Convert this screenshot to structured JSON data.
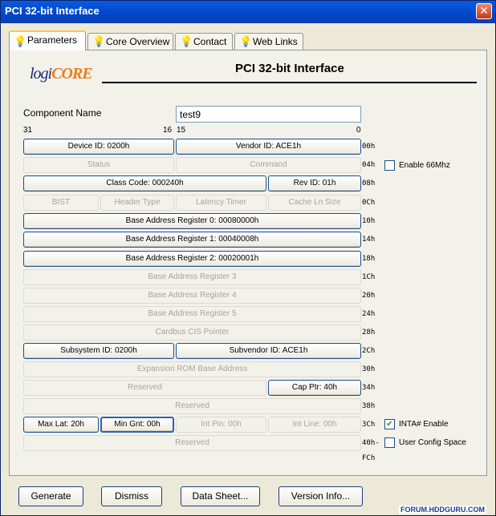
{
  "window": {
    "title": "PCI 32-bit Interface",
    "close_glyph": "✕"
  },
  "tabs": [
    {
      "label": "Parameters",
      "icon": "lightbulb-icon"
    },
    {
      "label": "Core Overview",
      "icon": "lightbulb-icon"
    },
    {
      "label": "Contact",
      "icon": "lightbulb-icon"
    },
    {
      "label": "Web Links",
      "icon": "lightbulb-icon"
    }
  ],
  "logo": {
    "text_a": "logi",
    "text_b": "CORE"
  },
  "heading": "PCI 32-bit Interface",
  "component": {
    "label": "Component Name",
    "value": "test9"
  },
  "bits": {
    "b31": "31",
    "b16": "16",
    "b15": "15",
    "b0": "0"
  },
  "rows": [
    {
      "offset": "00h",
      "cells": [
        {
          "text": "Device ID: 0200h",
          "enabled": true
        },
        {
          "text": "Vendor ID: ACE1h",
          "enabled": true
        }
      ]
    },
    {
      "offset": "04h",
      "cells": [
        {
          "text": "Status",
          "enabled": false
        },
        {
          "text": "Command",
          "enabled": false
        }
      ]
    },
    {
      "offset": "08h",
      "cells": [
        {
          "text": "Class Code: 000240h",
          "enabled": true
        },
        {
          "text": "Rev ID: 01h",
          "enabled": true
        }
      ]
    },
    {
      "offset": "0Ch",
      "cells": [
        {
          "text": "BIST",
          "enabled": false
        },
        {
          "text": "Header Type",
          "enabled": false
        },
        {
          "text": "Latency Timer",
          "enabled": false
        },
        {
          "text": "Cache Ln Size",
          "enabled": false
        }
      ]
    },
    {
      "offset": "10h",
      "cells": [
        {
          "text": "Base Address Register 0: 00080000h",
          "enabled": true
        }
      ]
    },
    {
      "offset": "14h",
      "cells": [
        {
          "text": "Base Address Register 1: 00040008h",
          "enabled": true
        }
      ]
    },
    {
      "offset": "18h",
      "cells": [
        {
          "text": "Base Address Register 2: 00020001h",
          "enabled": true
        }
      ]
    },
    {
      "offset": "1Ch",
      "cells": [
        {
          "text": "Base Address Register 3",
          "enabled": false
        }
      ]
    },
    {
      "offset": "20h",
      "cells": [
        {
          "text": "Base Address Register 4",
          "enabled": false
        }
      ]
    },
    {
      "offset": "24h",
      "cells": [
        {
          "text": "Base Address Register 5",
          "enabled": false
        }
      ]
    },
    {
      "offset": "28h",
      "cells": [
        {
          "text": "Cardbus CIS Pointer",
          "enabled": false
        }
      ]
    },
    {
      "offset": "2Ch",
      "cells": [
        {
          "text": "Subsystem ID: 0200h",
          "enabled": true
        },
        {
          "text": "Subvendor ID: ACE1h",
          "enabled": true
        }
      ]
    },
    {
      "offset": "30h",
      "cells": [
        {
          "text": "Expansion ROM Base Address",
          "enabled": false
        }
      ]
    },
    {
      "offset": "34h",
      "cells": [
        {
          "text": "Reserved",
          "enabled": false
        },
        {
          "text": "Cap Ptr: 40h",
          "enabled": true
        }
      ]
    },
    {
      "offset": "38h",
      "cells": [
        {
          "text": "Reserved",
          "enabled": false
        }
      ]
    },
    {
      "offset": "3Ch",
      "cells": [
        {
          "text": "Max Lat: 20h",
          "enabled": true
        },
        {
          "text": "Min Gnt: 00h",
          "enabled": true,
          "selected": true
        },
        {
          "text": "Int Pin: 00h",
          "enabled": false
        },
        {
          "text": "Int Line: 00h",
          "enabled": false
        }
      ]
    },
    {
      "offset": "40h-",
      "cells": [
        {
          "text": "Reserved",
          "enabled": false
        }
      ]
    }
  ],
  "last_offset": "FCh",
  "checkboxes": [
    {
      "label": "Enable 66Mhz",
      "checked": false
    },
    {
      "label": "INTA# Enable",
      "checked": true
    },
    {
      "label": "User Config Space",
      "checked": false
    }
  ],
  "buttons": {
    "generate": "Generate",
    "dismiss": "Dismiss",
    "datasheet": "Data Sheet...",
    "version": "Version Info..."
  },
  "watermark": "FORUM.HDDGURU.COM"
}
